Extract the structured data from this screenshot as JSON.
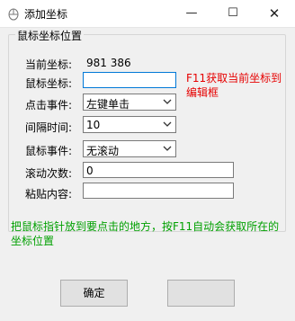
{
  "window": {
    "title": "添加坐标",
    "minimize_glyph": "—",
    "maximize_glyph": "☐",
    "close_glyph": "✕"
  },
  "group": {
    "legend": "鼠标坐标位置"
  },
  "current": {
    "label": "当前坐标:",
    "value": "981  386"
  },
  "coord": {
    "label": "鼠标坐标:",
    "value": ""
  },
  "hint_red": "F11获取当前坐标到编辑框",
  "click_event": {
    "label": "点击事件:",
    "selected": "左键单击"
  },
  "interval": {
    "label": "间隔时间:",
    "selected": "10"
  },
  "mouse_event": {
    "label": "鼠标事件:",
    "selected": "无滚动"
  },
  "scroll_count": {
    "label": "滚动次数:",
    "value": "0"
  },
  "paste": {
    "label": "粘贴内容:",
    "value": ""
  },
  "hint_green": "把鼠标指针放到要点击的地方，按F11自动会获取所在的坐标位置",
  "buttons": {
    "ok": "确定",
    "cancel": ""
  }
}
